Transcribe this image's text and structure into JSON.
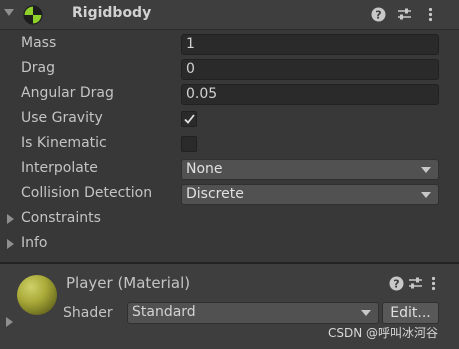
{
  "rigidbody": {
    "title": "Rigidbody",
    "properties": {
      "mass": {
        "label": "Mass",
        "value": "1"
      },
      "drag": {
        "label": "Drag",
        "value": "0"
      },
      "angular_drag": {
        "label": "Angular Drag",
        "value": "0.05"
      },
      "use_gravity": {
        "label": "Use Gravity",
        "checked": true
      },
      "is_kinematic": {
        "label": "Is Kinematic",
        "checked": false
      },
      "interpolate": {
        "label": "Interpolate",
        "value": "None"
      },
      "collision_detection": {
        "label": "Collision Detection",
        "value": "Discrete"
      }
    },
    "foldouts": {
      "constraints": "Constraints",
      "info": "Info"
    }
  },
  "material": {
    "title": "Player (Material)",
    "shader_label": "Shader",
    "shader_value": "Standard",
    "edit_label": "Edit..."
  },
  "icons": {
    "component": "rigidbody-icon",
    "help": "?",
    "presets": "presets-icon",
    "menu": "⋮"
  },
  "watermark": "CSDN @呼叫冰河谷",
  "colors": {
    "panel_bg": "#383838",
    "header_bg": "#3e3e3e",
    "field_bg": "#2a2a2a",
    "dropdown_bg": "#515151",
    "text": "#c4c4c4",
    "material_color": "#a9aa38"
  }
}
